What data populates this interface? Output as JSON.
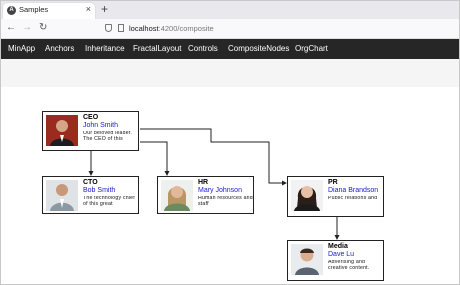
{
  "browser": {
    "tab_title": "Samples",
    "tab_close": "×",
    "new_tab": "+",
    "url_host": "localhost",
    "url_path": ":4200/composite"
  },
  "menu": {
    "items": [
      {
        "label": "MinApp"
      },
      {
        "label": "Anchors"
      },
      {
        "label": "Inheritance"
      },
      {
        "label": "FractalLayout"
      },
      {
        "label": "Controls"
      },
      {
        "label": "CompositeNodes"
      },
      {
        "label": "OrgChart"
      }
    ]
  },
  "org": {
    "nodes": [
      {
        "role": "CEO",
        "name": "John Smith",
        "description": "Our beloved leader. The CEO of this",
        "photo": "man-dark-suit-red-bg"
      },
      {
        "role": "CTO",
        "name": "Bob Smith",
        "description": "The technology chief of this great",
        "photo": "man-light-bg"
      },
      {
        "role": "HR",
        "name": "Mary Johnson",
        "description": "Human resources and staff",
        "photo": "woman-blonde"
      },
      {
        "role": "PR",
        "name": "Diana Brandson",
        "description": "Public relations and",
        "photo": "woman-dark-hair"
      },
      {
        "role": "Media",
        "name": "Dave Lu",
        "description": "Adverising and creative content.",
        "photo": "man-smiling"
      }
    ]
  }
}
